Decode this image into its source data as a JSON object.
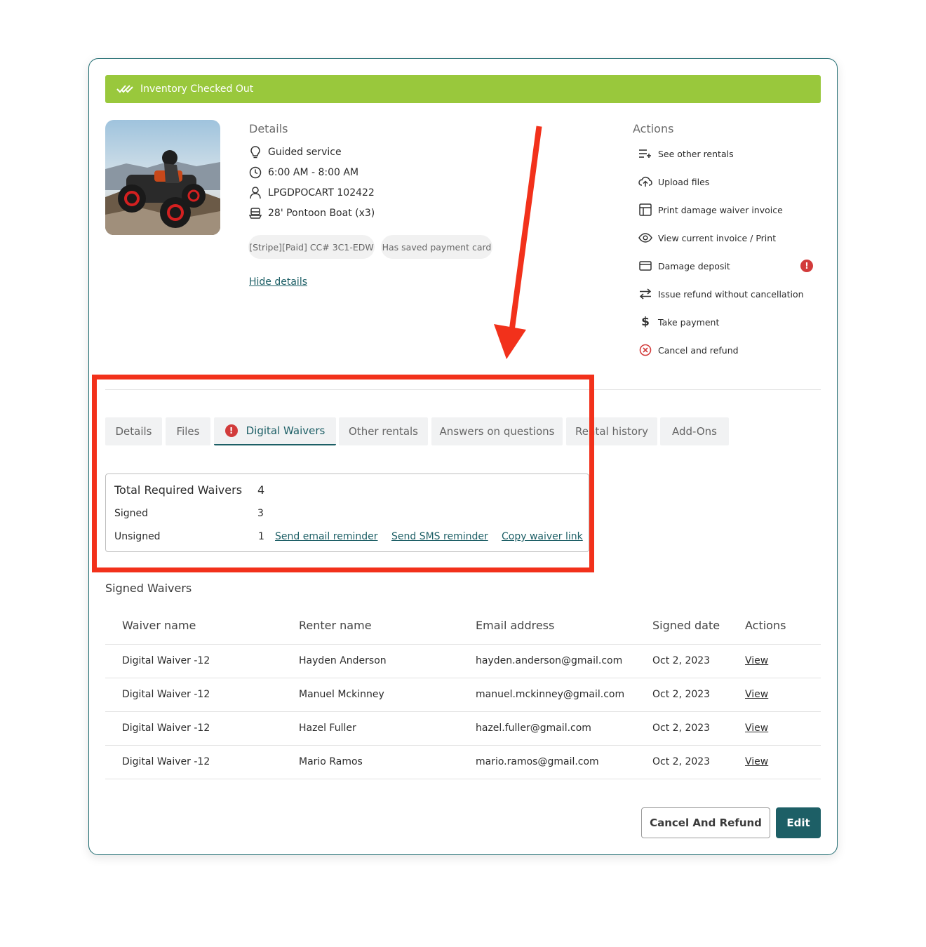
{
  "banner": {
    "text": "Inventory Checked Out",
    "icon": "double-check-icon",
    "color": "#99c83c"
  },
  "details": {
    "title": "Details",
    "items": [
      {
        "icon": "lightbulb-icon",
        "text": "Guided service"
      },
      {
        "icon": "clock-icon",
        "text": "6:00 AM - 8:00 AM"
      },
      {
        "icon": "user-icon",
        "text": "LPGDPOCART 102422"
      },
      {
        "icon": "boat-icon",
        "text": "28' Pontoon Boat (x3)"
      }
    ],
    "chips": [
      "[Stripe][Paid] CC# 3C1-EDW",
      "Has saved payment card"
    ],
    "hide_link": "Hide details"
  },
  "actions": {
    "title": "Actions",
    "items": [
      {
        "icon": "list-add-icon",
        "label": "See other rentals"
      },
      {
        "icon": "cloud-upload-icon",
        "label": "Upload files"
      },
      {
        "icon": "layout-icon",
        "label": "Print damage waiver invoice"
      },
      {
        "icon": "eye-icon",
        "label": "View current invoice / Print"
      },
      {
        "icon": "card-icon",
        "label": "Damage deposit",
        "alert": "!"
      },
      {
        "icon": "swap-icon",
        "label": "Issue refund without cancellation"
      },
      {
        "icon": "dollar-icon",
        "label": "Take payment"
      },
      {
        "icon": "x-circle-icon",
        "label": "Cancel and refund"
      }
    ]
  },
  "tabs": [
    {
      "label": "Details"
    },
    {
      "label": "Files"
    },
    {
      "label": "Digital Waivers",
      "alert": "!",
      "active": true
    },
    {
      "label": "Other rentals"
    },
    {
      "label": "Answers on questions"
    },
    {
      "label": "Rental history"
    },
    {
      "label": "Add-Ons"
    }
  ],
  "summary": {
    "total_label": "Total Required Waivers",
    "total_value": "4",
    "signed_label": "Signed",
    "signed_value": "3",
    "unsigned_label": "Unsigned",
    "unsigned_value": "1",
    "email_reminder": "Send email reminder",
    "sms_reminder": "Send SMS reminder",
    "copy_link": "Copy waiver link"
  },
  "signed_waivers": {
    "title": "Signed Waivers",
    "columns": [
      "Waiver name",
      "Renter name",
      "Email address",
      "Signed date",
      "Actions"
    ],
    "rows": [
      [
        "Digital Waiver -12",
        "Hayden Anderson",
        "hayden.anderson@gmail.com",
        "Oct 2, 2023",
        "View"
      ],
      [
        "Digital Waiver -12",
        "Manuel Mckinney",
        "manuel.mckinney@gmail.com",
        "Oct 2, 2023",
        "View"
      ],
      [
        "Digital Waiver -12",
        "Hazel Fuller",
        "hazel.fuller@gmail.com",
        "Oct 2, 2023",
        "View"
      ],
      [
        "Digital Waiver -12",
        "Mario Ramos",
        "mario.ramos@gmail.com",
        "Oct 2, 2023",
        "View"
      ]
    ]
  },
  "buttons": {
    "cancel_refund": "Cancel And Refund",
    "edit": "Edit"
  },
  "colors": {
    "accent": "#1d5f66",
    "alert": "#d23b3b",
    "annotation": "#f2311b"
  }
}
